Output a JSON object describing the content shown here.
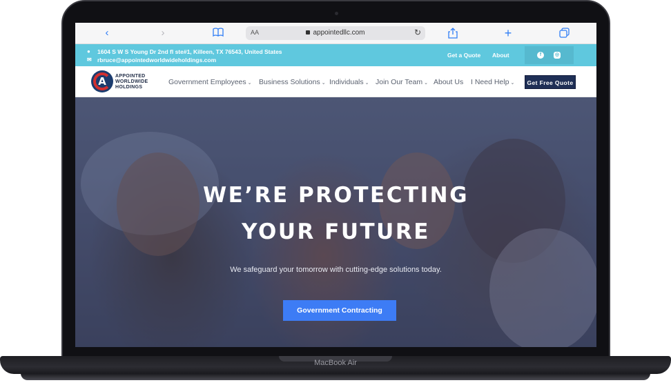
{
  "device": {
    "label": "MacBook Air"
  },
  "browser": {
    "reader_label": "AA",
    "url": "appointedllc.com",
    "icons": [
      "chevron-left-icon",
      "chevron-right-icon",
      "book-icon",
      "lock-icon",
      "reload-icon",
      "share-icon",
      "plus-icon",
      "tabs-icon"
    ]
  },
  "info_bar": {
    "address": "1604 S W S Young Dr 2nd fl ste#1, Killeen, TX 76543, United States",
    "email": "rbruce@appointedworldwideholdings.com",
    "links": [
      "Get a Quote",
      "About"
    ],
    "social": [
      "facebook-icon",
      "instagram-icon"
    ],
    "color": "#5fc8de"
  },
  "nav": {
    "logo_lines": [
      "APPOINTED",
      "WORLDWIDE",
      "HOLDINGS"
    ],
    "logo_letter": "A",
    "items": [
      {
        "label": "Government Employees",
        "dropdown": true
      },
      {
        "label": "Business Solutions",
        "dropdown": true
      },
      {
        "label": "Individuals",
        "dropdown": true
      },
      {
        "label": "Join Our Team",
        "dropdown": true
      },
      {
        "label": "About Us",
        "dropdown": false
      },
      {
        "label": "I Need Help",
        "dropdown": true
      }
    ],
    "cta": "Get Free Quote",
    "caret": "⌄"
  },
  "hero": {
    "title_line1": "WE’RE PROTECTING",
    "title_line2": "YOUR FUTURE",
    "subtitle": "We safeguard your tomorrow with cutting-edge solutions today.",
    "button": "Government Contracting",
    "button_color": "#3d7cf5"
  }
}
